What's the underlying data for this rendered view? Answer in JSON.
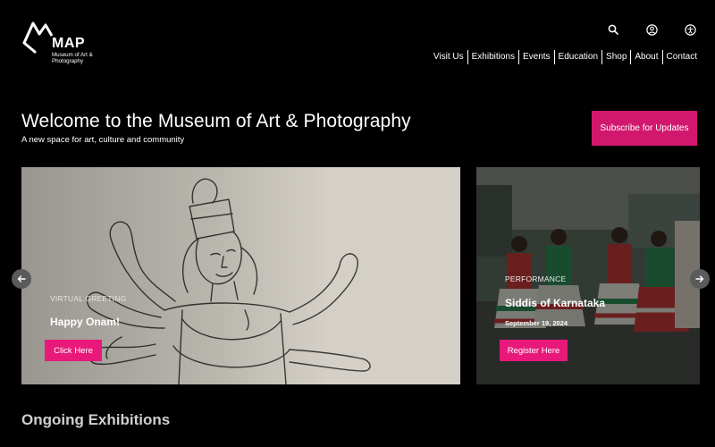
{
  "logo": {
    "title": "MAP",
    "subtitle": "Museum of Art & Photography",
    "icon": "map-logo-icon"
  },
  "header": {
    "icons": [
      "search-icon",
      "user-icon",
      "accessibility-icon"
    ],
    "nav": [
      "Visit Us",
      "Exhibitions",
      "Events",
      "Education",
      "Shop",
      "About",
      "Contact"
    ]
  },
  "hero": {
    "title": "Welcome to the Museum of Art & Photography",
    "subtitle": "A new space for art, culture and community",
    "subscribe_label": "Subscribe for Updates"
  },
  "carousel": {
    "slides": [
      {
        "category": "VIRTUAL GREETING",
        "title": "Happy Onam!",
        "date": "",
        "button": "Click Here"
      },
      {
        "category": "PERFORMANCE",
        "title": "Siddis of Karnataka",
        "date": "September 19, 2024",
        "button": "Register Here"
      }
    ],
    "prev_icon": "arrow-left-icon",
    "next_icon": "arrow-right-icon"
  },
  "sections": {
    "ongoing_title": "Ongoing Exhibitions"
  },
  "colors": {
    "accent": "#e8197a",
    "subscribe": "#d2186e",
    "background": "#000000"
  }
}
